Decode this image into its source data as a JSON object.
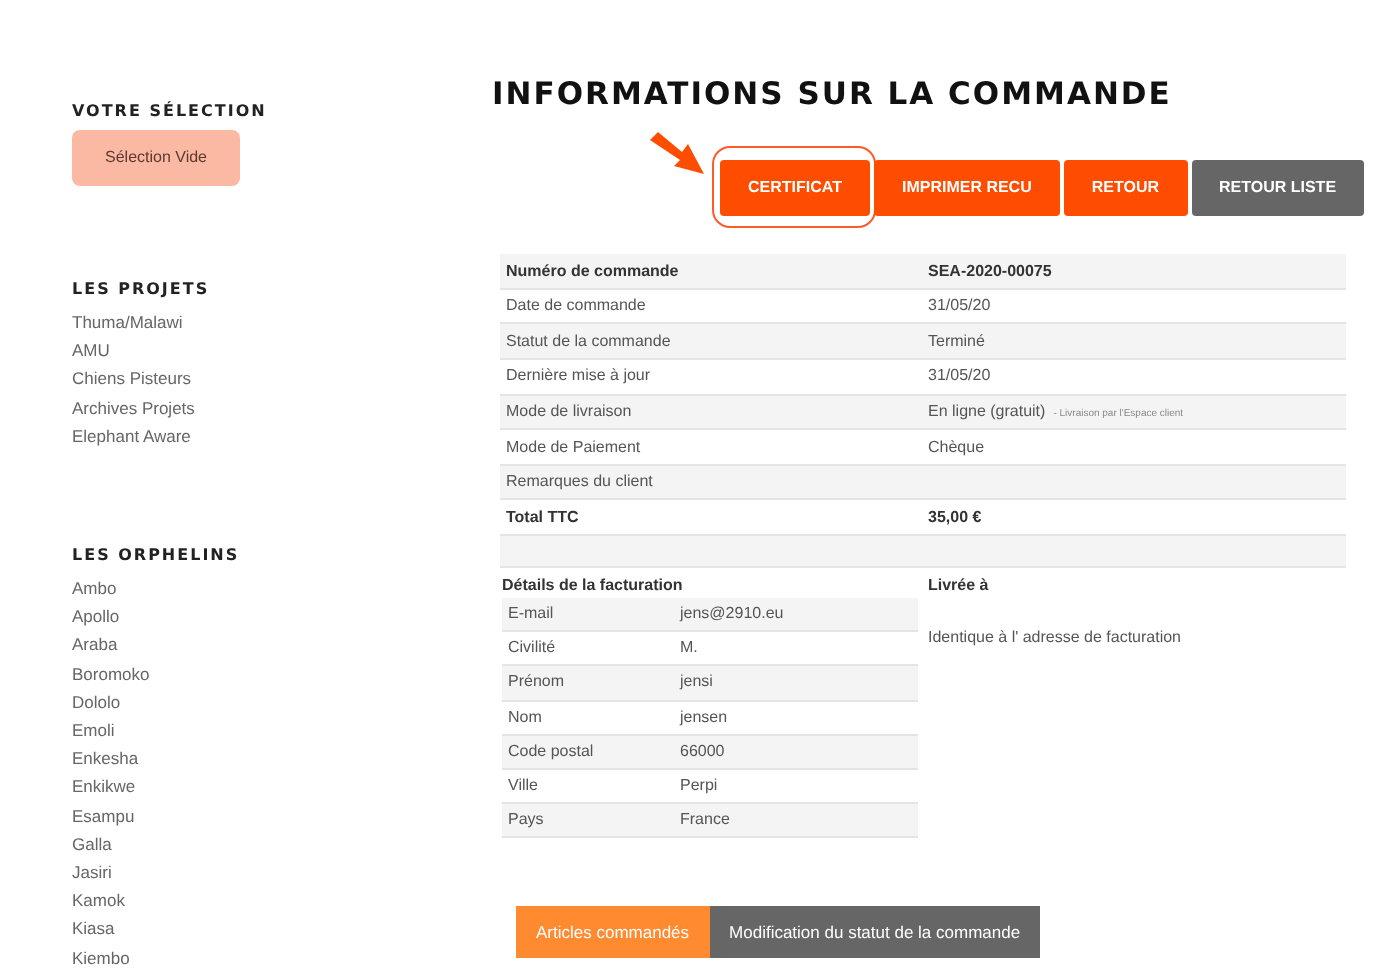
{
  "sidebar": {
    "selection": {
      "title": "VOTRE SÉLECTION",
      "box": "Sélection Vide"
    },
    "sections": [
      {
        "title": "LES PROJETS",
        "items": [
          "Thuma/Malawi",
          "AMU",
          "Chiens Pisteurs",
          "Archives Projets",
          "Elephant Aware"
        ]
      },
      {
        "title": "LES ORPHELINS",
        "items": [
          "Ambo",
          "Apollo",
          "Araba",
          "Boromoko",
          "Dololo",
          "Emoli",
          "Enkesha",
          "Enkikwe",
          "Esampu",
          "Galla",
          "Jasiri",
          "Kamok",
          "Kiasa",
          "Kiembo"
        ]
      }
    ]
  },
  "page_title": "INFORMATIONS SUR LA COMMANDE",
  "buttons": [
    {
      "label": "CERTIFICAT",
      "kind": "primary",
      "highlighted": true
    },
    {
      "label": "IMPRIMER RECU",
      "kind": "primary",
      "highlighted": false
    },
    {
      "label": "RETOUR",
      "kind": "primary",
      "highlighted": false
    },
    {
      "label": "RETOUR LISTE",
      "kind": "secondary",
      "highlighted": false
    }
  ],
  "order_rows": [
    {
      "label": "Numéro de commande",
      "value": "SEA-2020-00075",
      "bold": true
    },
    {
      "label": "Date de commande",
      "value": "31/05/20",
      "bold": false
    },
    {
      "label": "Statut de la commande",
      "value": "Terminé",
      "bold": false
    },
    {
      "label": "Dernière mise à jour",
      "value": "31/05/20",
      "bold": false
    },
    {
      "label": "Mode de livraison",
      "value": "En ligne (gratuit)",
      "note": "- Livraison par l'Espace client",
      "bold": false
    },
    {
      "label": "Mode de Paiement",
      "value": "Chèque",
      "bold": false
    },
    {
      "label": "Remarques du client",
      "bold": false
    },
    {
      "label": "Total TTC",
      "value": "35,00 €",
      "bold": true
    }
  ],
  "billing": {
    "title": "Détails de la facturation",
    "rows": [
      {
        "label": "E-mail",
        "value": "jens@2910.eu"
      },
      {
        "label": "Civilité",
        "value": "M."
      },
      {
        "label": "Prénom",
        "value": "jensi"
      },
      {
        "label": "Nom",
        "value": "jensen"
      },
      {
        "label": "Code postal",
        "value": "66000"
      },
      {
        "label": "Ville",
        "value": "Perpi"
      },
      {
        "label": "Pays",
        "value": "France"
      }
    ]
  },
  "delivery": {
    "title": "Livrée à",
    "text": "Identique à l' adresse de facturation"
  },
  "tabs": [
    {
      "label": "Articles commandés",
      "selected": true
    },
    {
      "label": "Modification du statut de la commande",
      "selected": false
    }
  ]
}
